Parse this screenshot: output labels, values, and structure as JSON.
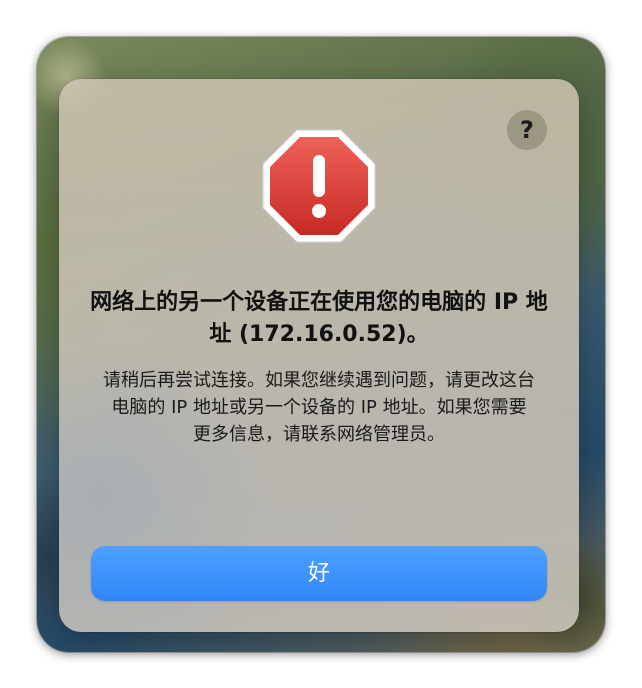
{
  "dialog": {
    "help_label": "?",
    "title": "网络上的另一个设备正在使用您的电脑的 IP 地址 (172.16.0.52)。",
    "message": "请稍后再尝试连接。如果您继续遇到问题，请更改这台电脑的 IP 地址或另一个设备的 IP 地址。如果您需要更多信息，请联系网络管理员。",
    "ok_label": "好",
    "icon": "stop-alert-icon"
  },
  "colors": {
    "accent": "#2f86f7",
    "alert_red": "#d8332d"
  }
}
